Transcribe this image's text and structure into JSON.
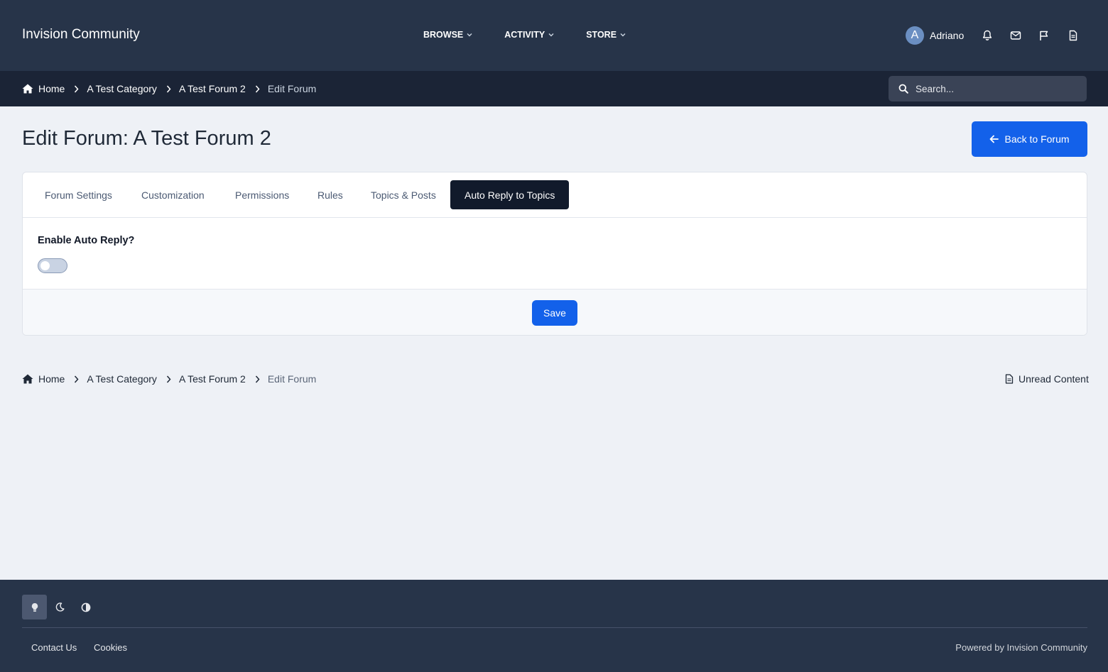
{
  "header": {
    "site_title": "Invision Community",
    "nav": [
      {
        "label": "BROWSE"
      },
      {
        "label": "ACTIVITY"
      },
      {
        "label": "STORE"
      }
    ],
    "user": {
      "initial": "A",
      "name": "Adriano"
    },
    "icons": [
      "bell-icon",
      "envelope-icon",
      "flag-icon",
      "document-icon"
    ]
  },
  "breadcrumb": {
    "items": [
      "Home",
      "A Test Category",
      "A Test Forum 2",
      "Edit Forum"
    ]
  },
  "search": {
    "placeholder": "Search..."
  },
  "page": {
    "title": "Edit Forum: A Test Forum 2",
    "back_button": "Back to Forum"
  },
  "tabs": [
    {
      "label": "Forum Settings",
      "active": false
    },
    {
      "label": "Customization",
      "active": false
    },
    {
      "label": "Permissions",
      "active": false
    },
    {
      "label": "Rules",
      "active": false
    },
    {
      "label": "Topics & Posts",
      "active": false
    },
    {
      "label": "Auto Reply to Topics",
      "active": true
    }
  ],
  "form": {
    "enable_auto_reply_label": "Enable Auto Reply?",
    "enable_auto_reply_value": false,
    "save_label": "Save"
  },
  "bottom": {
    "unread_content": "Unread Content"
  },
  "footer": {
    "theme_options": [
      "light-mode-icon",
      "dark-mode-icon",
      "contrast-mode-icon"
    ],
    "links": [
      "Contact Us",
      "Cookies"
    ],
    "powered_by": "Powered by Invision Community"
  },
  "colors": {
    "header_bg": "#273449",
    "crumbbar_bg": "#1b2436",
    "accent": "#1361ea",
    "active_tab_bg": "#111a2b",
    "page_bg": "#eef1f6"
  }
}
